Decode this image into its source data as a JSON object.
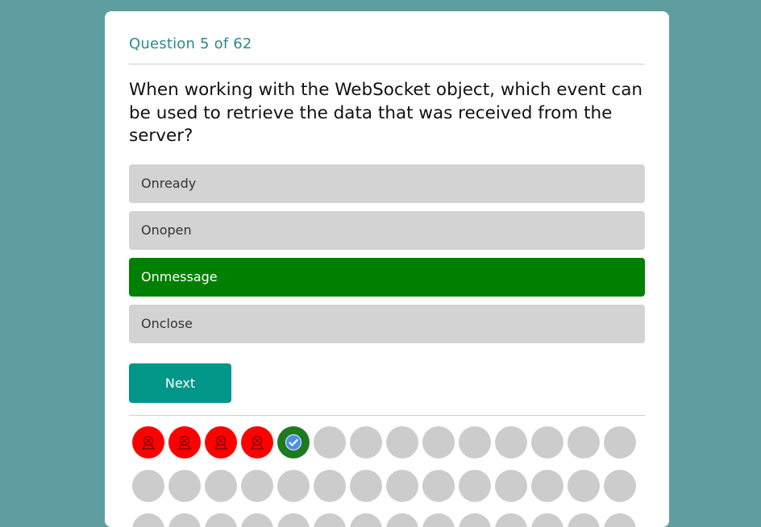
{
  "quiz": {
    "counter": "Question 5 of 62",
    "question": "When working with the WebSocket object, which event can be used to retrieve the data that was received from the server?",
    "options": [
      {
        "label": "Onready",
        "state": "default"
      },
      {
        "label": "Onopen",
        "state": "default"
      },
      {
        "label": "Onmessage",
        "state": "correct"
      },
      {
        "label": "Onclose",
        "state": "default"
      }
    ],
    "next_label": "Next"
  },
  "progress": {
    "total_questions": 62,
    "statuses": [
      "wrong",
      "wrong",
      "wrong",
      "wrong",
      "correct"
    ],
    "icons": {
      "wrong": "wrong-answer-icon",
      "correct": "check-icon"
    }
  },
  "colors": {
    "background": "#5f9ea0",
    "accent": "#009688",
    "correct": "#008000",
    "wrong": "#ff0000",
    "option_bg": "#d3d3d3",
    "unanswered": "#cccccc"
  }
}
